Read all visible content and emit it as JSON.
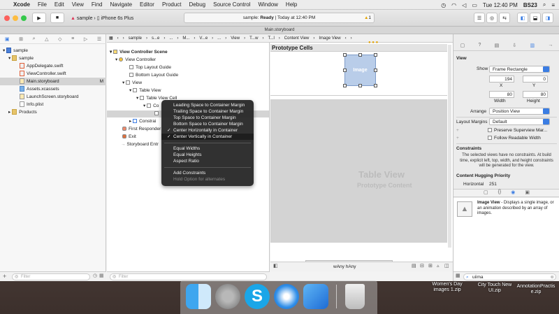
{
  "menubar": {
    "apple": "",
    "app": "Xcode",
    "items": [
      "File",
      "Edit",
      "View",
      "Find",
      "Navigate",
      "Editor",
      "Product",
      "Debug",
      "Source Control",
      "Window",
      "Help"
    ],
    "clock": "Tue 12:40 PM",
    "user": "BS23"
  },
  "toolbar": {
    "scheme": "sample",
    "device": "iPhone 6s Plus",
    "status_project": "sample:",
    "status_state": "Ready",
    "status_time": "Today at 12:40 PM",
    "warning_count": "1"
  },
  "tabbar": {
    "title": "Main.storyboard"
  },
  "navigator": {
    "project": "sample",
    "group": "sample",
    "files": [
      "AppDelegate.swift",
      "ViewController.swift",
      "Main.storyboard",
      "Assets.xcassets",
      "LaunchScreen.storyboard",
      "Info.plist"
    ],
    "selected_badge": "M",
    "products": "Products",
    "filter_placeholder": "Filter"
  },
  "jumpbar": {
    "items": [
      "sample",
      "s...e",
      "...",
      "M...",
      "V...e",
      "...",
      "View",
      "T...w",
      "T...l",
      "Content View",
      "Image View"
    ]
  },
  "outline": {
    "scene": "View Controller Scene",
    "rows": [
      "View Controller",
      "Top Layout Guide",
      "Bottom Layout Guide",
      "View",
      "Table View",
      "Table View Cell",
      "Co",
      "Constrai",
      "First Responder",
      "Exit",
      "Storyboard Entr"
    ],
    "filter_placeholder": "Filter"
  },
  "context_menu": {
    "items": [
      {
        "label": "Leading Space to Container Margin",
        "checked": false
      },
      {
        "label": "Trailing Space to Container Margin",
        "checked": false
      },
      {
        "label": "Top Space to Container Margin",
        "checked": false
      },
      {
        "label": "Bottom Space to Container Margin",
        "checked": false
      },
      {
        "label": "Center Horizontally in Container",
        "checked": true
      },
      {
        "label": "Center Vertically in Container",
        "checked": true
      }
    ],
    "group2": [
      "Equal Widths",
      "Equal Heights",
      "Aspect Ratio"
    ],
    "add": "Add Constraints",
    "hint": "Hold Option for alternates",
    "check_glyph": "✓"
  },
  "canvas": {
    "header": "Prototype Cells",
    "image_label": "Image",
    "table_title": "Table View",
    "table_subtitle": "Prototype Content",
    "size_class": "wAny hAny"
  },
  "inspector": {
    "section": "View",
    "show_label": "Show",
    "show_value": "Frame Rectangle",
    "x": "194",
    "y": "0",
    "x_label": "X",
    "y_label": "Y",
    "width": "80",
    "height": "80",
    "width_label": "Width",
    "height_label": "Height",
    "arrange_label": "Arrange",
    "arrange_value": "Position View",
    "margins_label": "Layout Margins",
    "margins_value": "Default",
    "preserve_label": "Preserve Superview Mar...",
    "follow_label": "Follow Readable Width",
    "constraints_title": "Constraints",
    "constraints_text": "The selected views have no constraints. At build time, explicit left, top, width, and height constraints will be generated for the view.",
    "hugging_title": "Content Hugging Priority",
    "horizontal_label": "Horizontal",
    "horizontal_value": "251",
    "library_title": "Image View",
    "library_desc": " - Displays a single image, or an animation described by an array of images.",
    "search_value": "uiima"
  },
  "desktop": {
    "files": [
      "Women's Day images 1.zip",
      "City Touch New UI.zip",
      "AnnotationPractis e.zip"
    ]
  },
  "colors": {
    "accent": "#3b7de3",
    "selection": "#d4d4d4",
    "image_fill": "#b9cde9"
  }
}
